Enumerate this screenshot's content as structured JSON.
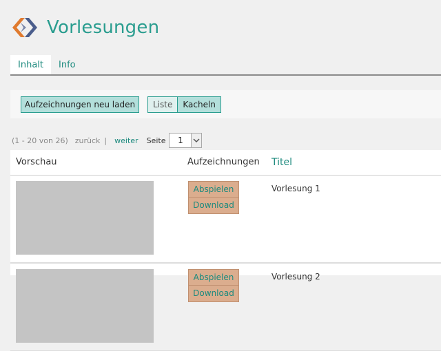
{
  "header": {
    "title": "Vorlesungen",
    "logo_icon": "chevrons-logo-icon"
  },
  "tabs": [
    {
      "label": "Inhalt",
      "active": true
    },
    {
      "label": "Info",
      "active": false
    }
  ],
  "toolbar": {
    "reload_label": "Aufzeichnungen neu laden",
    "view_list_label": "Liste",
    "view_tiles_label": "Kacheln",
    "selected_view": "Kacheln"
  },
  "pager": {
    "range": "(1 - 20 von 26)",
    "prev": "zurück",
    "separator": "|",
    "next": "weiter",
    "page_label": "Seite",
    "page_value": "1"
  },
  "table": {
    "columns": [
      "Vorschau",
      "Aufzeichnungen",
      "Titel"
    ],
    "rows": [
      {
        "title": "Vorlesung 1",
        "play": "Abspielen",
        "download": "Download"
      },
      {
        "title": "Vorlesung 2",
        "play": "Abspielen",
        "download": "Download"
      }
    ]
  },
  "colors": {
    "accent": "#2a9d8f",
    "action_button": "#dbad8e",
    "logo_orange": "#e07a2e",
    "logo_blue": "#4a5d8c"
  }
}
